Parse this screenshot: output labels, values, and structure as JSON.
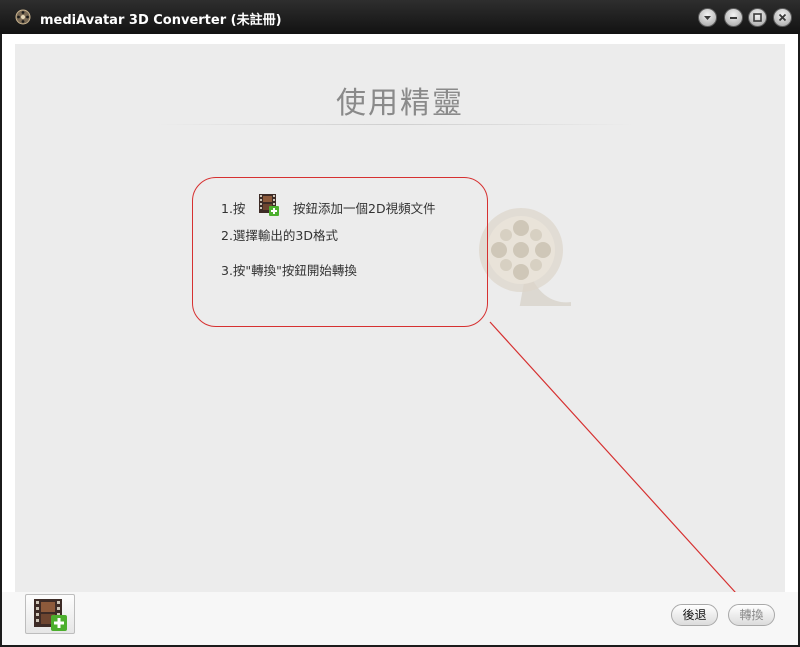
{
  "window": {
    "title": "mediAvatar 3D Converter (未註冊)",
    "controls": [
      "dropdown-icon",
      "minimize-icon",
      "maximize-icon",
      "close-icon"
    ]
  },
  "wizard": {
    "title": "使用精靈",
    "steps": {
      "step1_prefix": "1.按",
      "step1_icon": "add-video-icon",
      "step1_suffix": "按鈕添加一個2D視頻文件",
      "step2": "2.選擇輸出的3D格式",
      "step3": "3.按\"轉換\"按鈕開始轉換"
    },
    "callout_color": "#d63030"
  },
  "footer": {
    "add_video_icon": "add-video-icon",
    "back_label": "後退",
    "convert_label": "轉換"
  }
}
